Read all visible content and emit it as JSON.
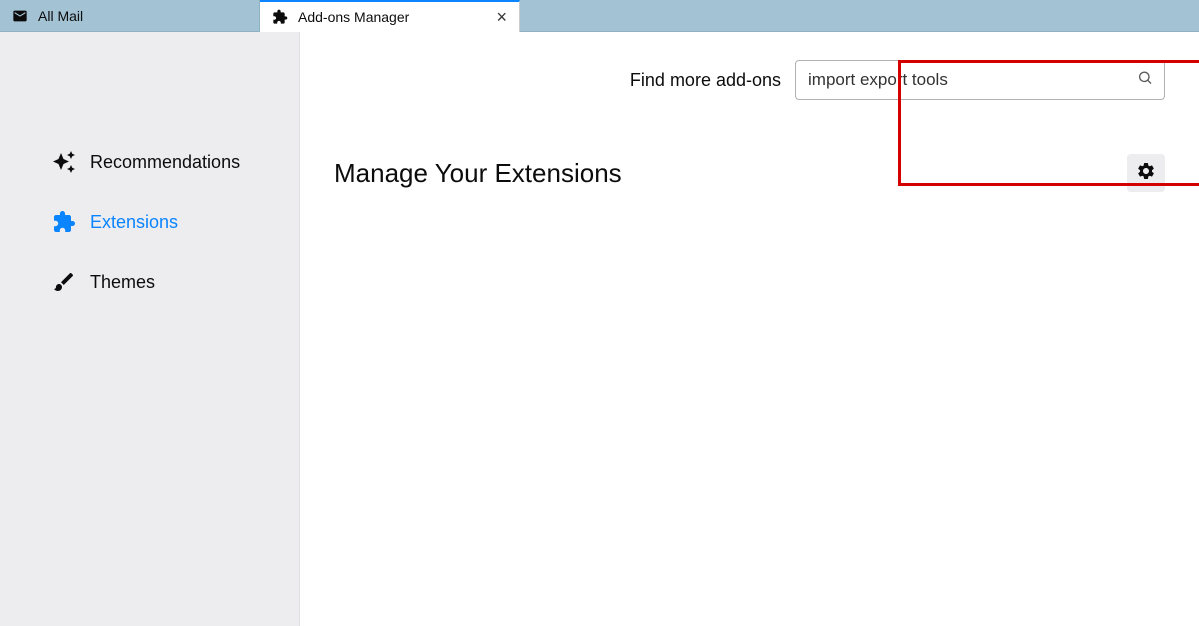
{
  "tabs": {
    "mail": {
      "label": "All Mail"
    },
    "addons": {
      "label": "Add-ons Manager"
    }
  },
  "sidebar": {
    "recommendations": {
      "label": "Recommendations"
    },
    "extensions": {
      "label": "Extensions"
    },
    "themes": {
      "label": "Themes"
    }
  },
  "search": {
    "label": "Find more add-ons",
    "value": "import export tools"
  },
  "main": {
    "heading": "Manage Your Extensions"
  }
}
